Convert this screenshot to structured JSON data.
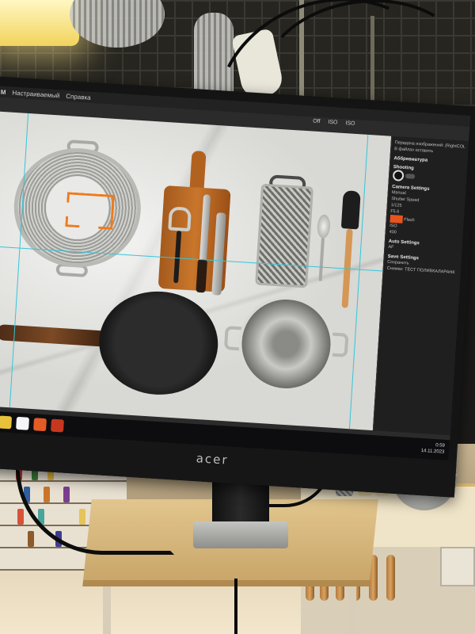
{
  "monitor": {
    "brand": "acer"
  },
  "app": {
    "title_items": [
      "M",
      "Настраиваемый",
      "Справка"
    ],
    "toolbar_items": [
      "Off",
      "ISO",
      "ISO"
    ]
  },
  "panel": {
    "rows": [
      "Передача изображений: (RightCOLAVA)",
      "В файлах оставить",
      "Аббревиатура",
      "Shooting",
      "Camera Settings",
      "Manual",
      "Shutter Speed",
      "1/125",
      "F5.6",
      "Flash",
      "ISO",
      "400",
      "Auto Settings",
      "AF",
      "Save Settings",
      "Сохранить",
      "Снимки: ТЕСТ ПОЛИВКАЛАРАНК"
    ]
  },
  "taskbar": {
    "time": "0:59",
    "date": "14.11.2023"
  },
  "colors": {
    "focus_bracket": "#f07a1a",
    "guide_lines": "#35c6d9",
    "panel_bg": "#1f1f1f",
    "accent_orange": "#e8541e"
  }
}
